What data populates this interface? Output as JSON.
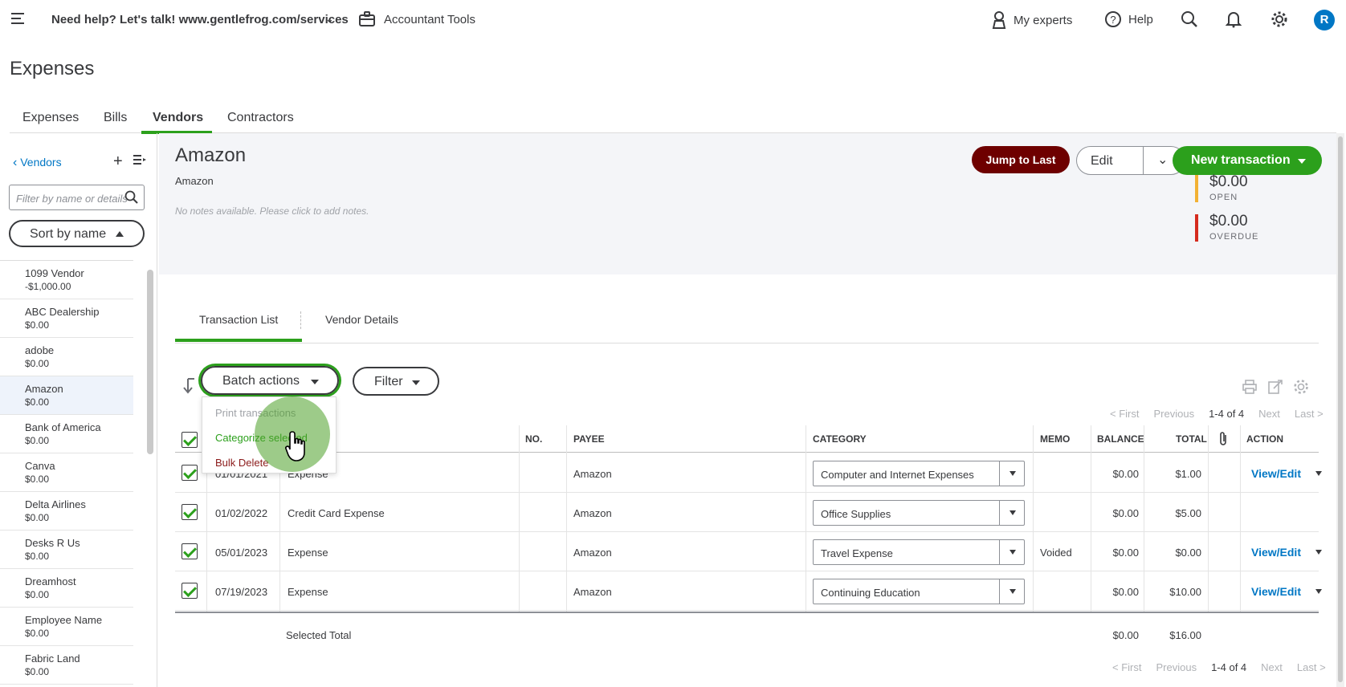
{
  "topbar": {
    "help_text": "Need help? Let's talk! www.gentlefrog.com/services",
    "accountant_tools": "Accountant Tools",
    "my_experts": "My experts",
    "help": "Help",
    "avatar_initial": "R"
  },
  "page_title": "Expenses",
  "main_tabs": [
    "Expenses",
    "Bills",
    "Vendors",
    "Contractors"
  ],
  "sidebar": {
    "back_label": "Vendors",
    "filter_placeholder": "Filter by name or details",
    "sort_label": "Sort by name",
    "vendors": [
      {
        "name": "1099 Vendor",
        "balance": "-$1,000.00"
      },
      {
        "name": "ABC Dealership",
        "balance": "$0.00"
      },
      {
        "name": "adobe",
        "balance": "$0.00"
      },
      {
        "name": "Amazon",
        "balance": "$0.00"
      },
      {
        "name": "Bank of America",
        "balance": "$0.00"
      },
      {
        "name": "Canva",
        "balance": "$0.00"
      },
      {
        "name": "Delta Airlines",
        "balance": "$0.00"
      },
      {
        "name": "Desks R Us",
        "balance": "$0.00"
      },
      {
        "name": "Dreamhost",
        "balance": "$0.00"
      },
      {
        "name": "Employee Name",
        "balance": "$0.00"
      },
      {
        "name": "Fabric Land",
        "balance": "$0.00"
      }
    ]
  },
  "vendor": {
    "name": "Amazon",
    "company": "Amazon",
    "notes": "No notes available. Please click to add notes.",
    "jump_label": "Jump to Last",
    "edit_label": "Edit",
    "new_tx_label": "New transaction",
    "open_amount": "$0.00",
    "open_label": "OPEN",
    "overdue_amount": "$0.00",
    "overdue_label": "OVERDUE",
    "open_color": "#f2b134",
    "overdue_color": "#d52b1e"
  },
  "sub_tabs": [
    "Transaction List",
    "Vendor Details"
  ],
  "actions": {
    "batch_label": "Batch actions",
    "filter_label": "Filter",
    "dropdown": {
      "print": "Print transactions",
      "categorize": "Categorize selected",
      "bulk_delete": "Bulk Delete"
    }
  },
  "pager": {
    "first": "< First",
    "previous": "Previous",
    "range": "1-4 of 4",
    "next": "Next",
    "last": "Last >"
  },
  "table": {
    "headers": {
      "no": "NO.",
      "payee": "PAYEE",
      "category": "CATEGORY",
      "memo": "MEMO",
      "balance": "BALANCE",
      "total": "TOTAL",
      "action": "ACTION"
    },
    "rows": [
      {
        "date": "01/01/2021",
        "type": "Expense",
        "payee": "Amazon",
        "category": "Computer and Internet Expenses",
        "memo": "",
        "balance": "$0.00",
        "total": "$1.00",
        "action": "View/Edit"
      },
      {
        "date": "01/02/2022",
        "type": "Credit Card Expense",
        "payee": "Amazon",
        "category": "Office Supplies",
        "memo": "",
        "balance": "$0.00",
        "total": "$5.00",
        "action": ""
      },
      {
        "date": "05/01/2023",
        "type": "Expense",
        "payee": "Amazon",
        "category": "Travel Expense",
        "memo": "Voided",
        "balance": "$0.00",
        "total": "$0.00",
        "action": "View/Edit"
      },
      {
        "date": "07/19/2023",
        "type": "Expense",
        "payee": "Amazon",
        "category": "Continuing Education",
        "memo": "",
        "balance": "$0.00",
        "total": "$10.00",
        "action": "View/Edit"
      }
    ],
    "selected_total_label": "Selected Total",
    "selected_balance": "$0.00",
    "selected_total": "$16.00"
  }
}
